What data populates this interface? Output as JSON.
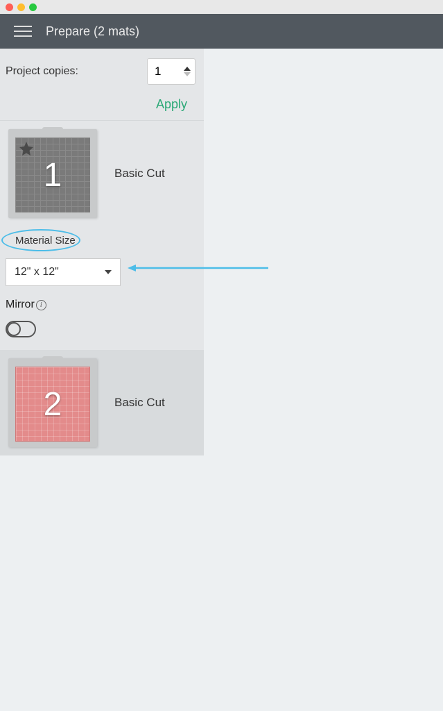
{
  "header": {
    "title": "Prepare (2 mats)"
  },
  "project_copies": {
    "label": "Project copies:",
    "value": "1",
    "apply_label": "Apply"
  },
  "mat1": {
    "number": "1",
    "label": "Basic Cut"
  },
  "material_size": {
    "label": "Material Size",
    "value": "12\" x 12\""
  },
  "mirror": {
    "label": "Mirror",
    "enabled": false
  },
  "mat2": {
    "number": "2",
    "label": "Basic Cut"
  },
  "colors": {
    "header_bg": "#51585f",
    "apply": "#2aa876",
    "annotation": "#4dbde8",
    "mat2_fill": "#e38b8b"
  }
}
